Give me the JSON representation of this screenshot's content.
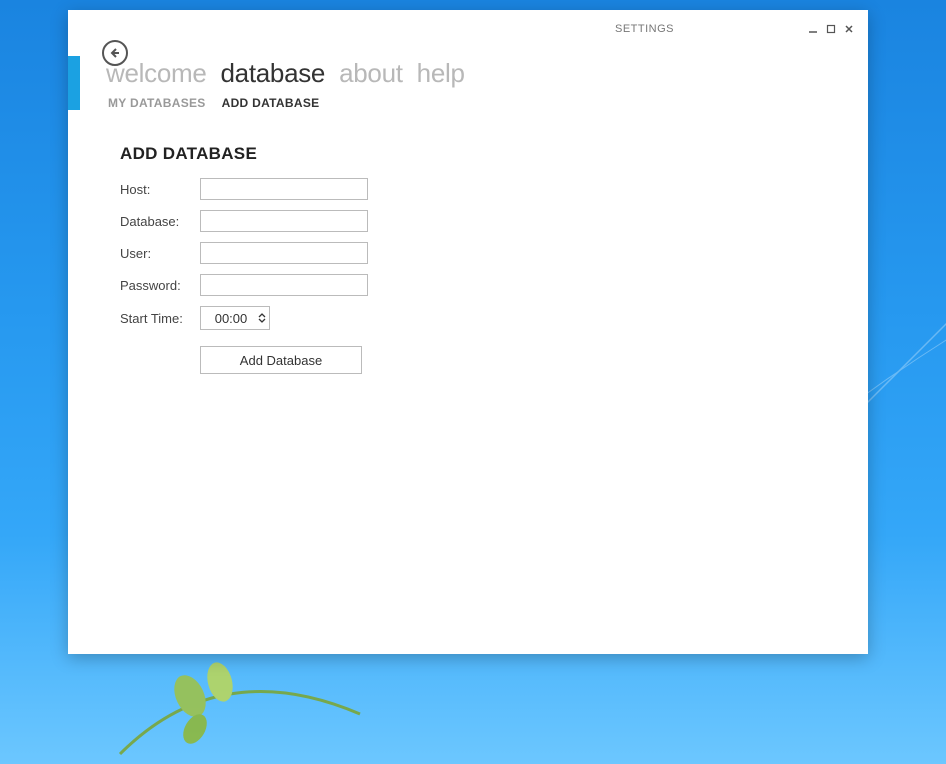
{
  "titlebar": {
    "settings_label": "SETTINGS"
  },
  "nav": {
    "top_tabs": [
      {
        "label": "welcome",
        "active": false
      },
      {
        "label": "database",
        "active": true
      },
      {
        "label": "about",
        "active": false
      },
      {
        "label": "help",
        "active": false
      }
    ],
    "sub_tabs": [
      {
        "label": "MY DATABASES",
        "active": false
      },
      {
        "label": "ADD DATABASE",
        "active": true
      }
    ]
  },
  "page": {
    "title": "ADD DATABASE",
    "fields": {
      "host": {
        "label": "Host:",
        "value": ""
      },
      "database": {
        "label": "Database:",
        "value": ""
      },
      "user": {
        "label": "User:",
        "value": ""
      },
      "password": {
        "label": "Password:",
        "value": ""
      },
      "start_time": {
        "label": "Start Time:",
        "value": "00:00"
      }
    },
    "submit_label": "Add Database"
  }
}
